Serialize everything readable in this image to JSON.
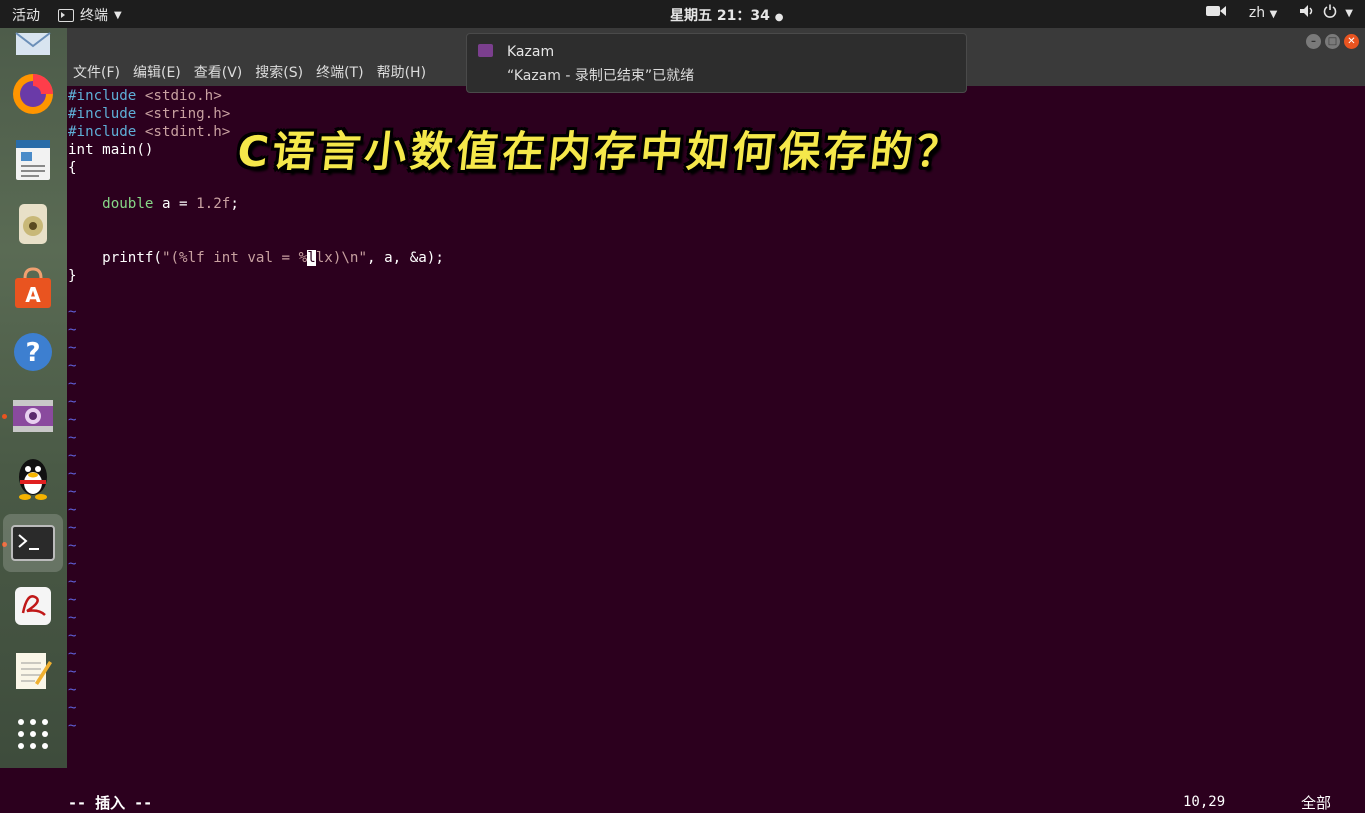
{
  "topbar": {
    "activities": "活动",
    "app_name": "终端",
    "clock": "星期五 21：34",
    "lang": "zh"
  },
  "menu": [
    "文件(F)",
    "编辑(E)",
    "查看(V)",
    "搜索(S)",
    "终端(T)",
    "帮助(H)"
  ],
  "notification": {
    "title": "Kazam",
    "body": "“Kazam - 录制已结束”已就绪"
  },
  "caption": "C语言小数值在内存中如何保存的？",
  "code": {
    "l1a": "#include ",
    "l1b": "<stdio.h>",
    "l2a": "#include ",
    "l2b": "<string.h>",
    "l3a": "#include ",
    "l3b": "<stdint.h>",
    "l4": "int main()",
    "l5": "{",
    "l7_type": "double",
    "l7_mid": " a = ",
    "l7_num": "1.2f",
    "l7_end": ";",
    "l10_fn": "    printf(",
    "l10_s1": "\"(%lf int val = %",
    "l10_cur": "l",
    "l10_s2": "lx)\\n\"",
    "l10_end": ", a, &a);",
    "l11": "}"
  },
  "tilde": "~",
  "status": {
    "mode": "-- 插入 --",
    "position": "10,29",
    "scope": "全部"
  },
  "colors": {
    "terminal_bg": "#2c001e",
    "accent": "#e95420",
    "caption": "#f5e84a"
  }
}
